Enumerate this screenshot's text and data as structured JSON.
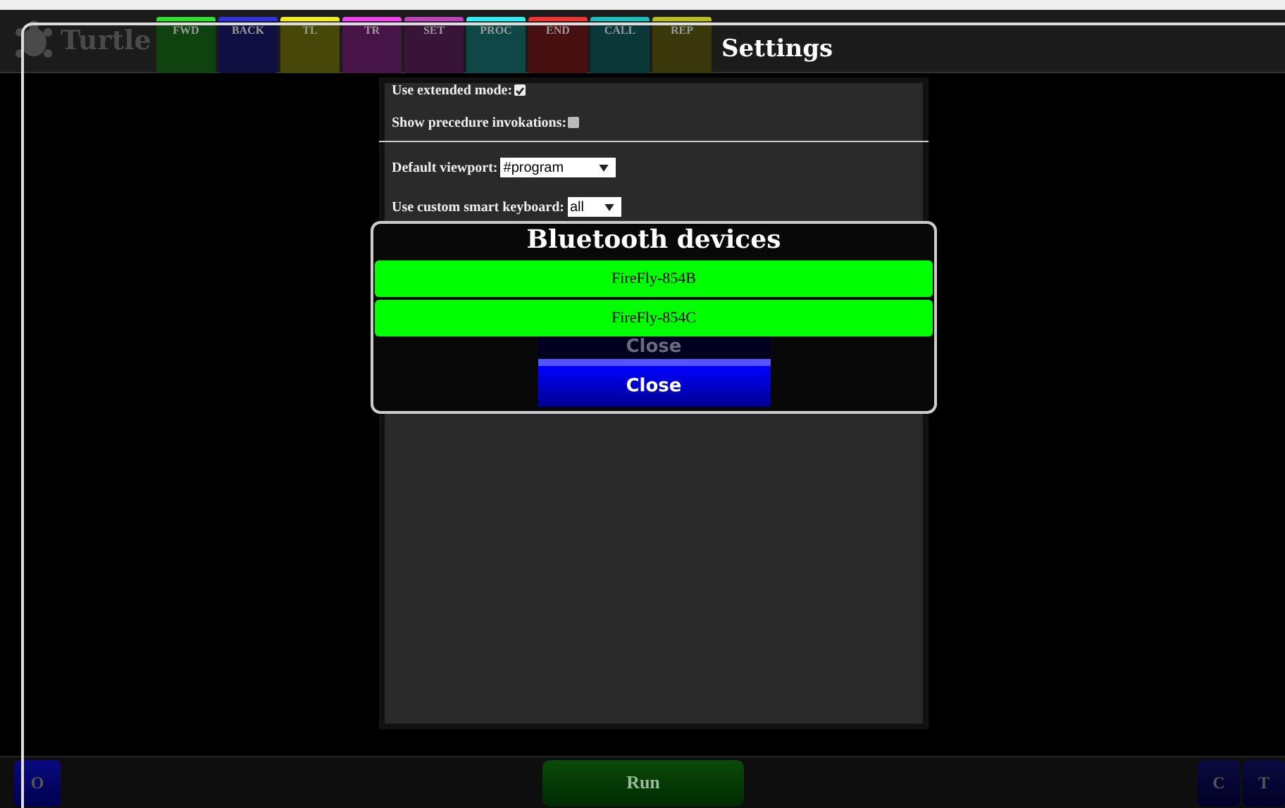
{
  "app": {
    "name": "Turtle"
  },
  "commands": [
    {
      "label": "FWD",
      "color": "#33dd33"
    },
    {
      "label": "BACK",
      "color": "#3333dd"
    },
    {
      "label": "TL",
      "color": "#eeee22"
    },
    {
      "label": "TR",
      "color": "#ee44ee"
    },
    {
      "label": "SET",
      "color": "#bb44bb"
    },
    {
      "label": "PROC",
      "color": "#33eeee"
    },
    {
      "label": "END",
      "color": "#ee3333"
    },
    {
      "label": "CALL",
      "color": "#22bbbb"
    },
    {
      "label": "REP",
      "color": "#bbbb22"
    }
  ],
  "page_title": "Settings",
  "settings": [
    {
      "kind": "checkbox",
      "label": "Use extended mode:",
      "checked": true
    },
    {
      "kind": "checkbox",
      "label": "Show precedure invokations:",
      "checked": false
    },
    {
      "kind": "divider"
    },
    {
      "kind": "select",
      "label": "Default viewport:",
      "value": "#program"
    },
    {
      "kind": "select",
      "label": "Use custom smart keyboard:",
      "value": "all"
    }
  ],
  "dialog": {
    "title": "Bluetooth devices",
    "devices": [
      "FireFly-854B",
      "FireFly-854C"
    ],
    "hidden_button": "Close",
    "close_button": "Close"
  },
  "bottom_bar": {
    "left_buttons": [
      "O"
    ],
    "run_button": "Run",
    "right_buttons": [
      "C",
      "T"
    ]
  }
}
